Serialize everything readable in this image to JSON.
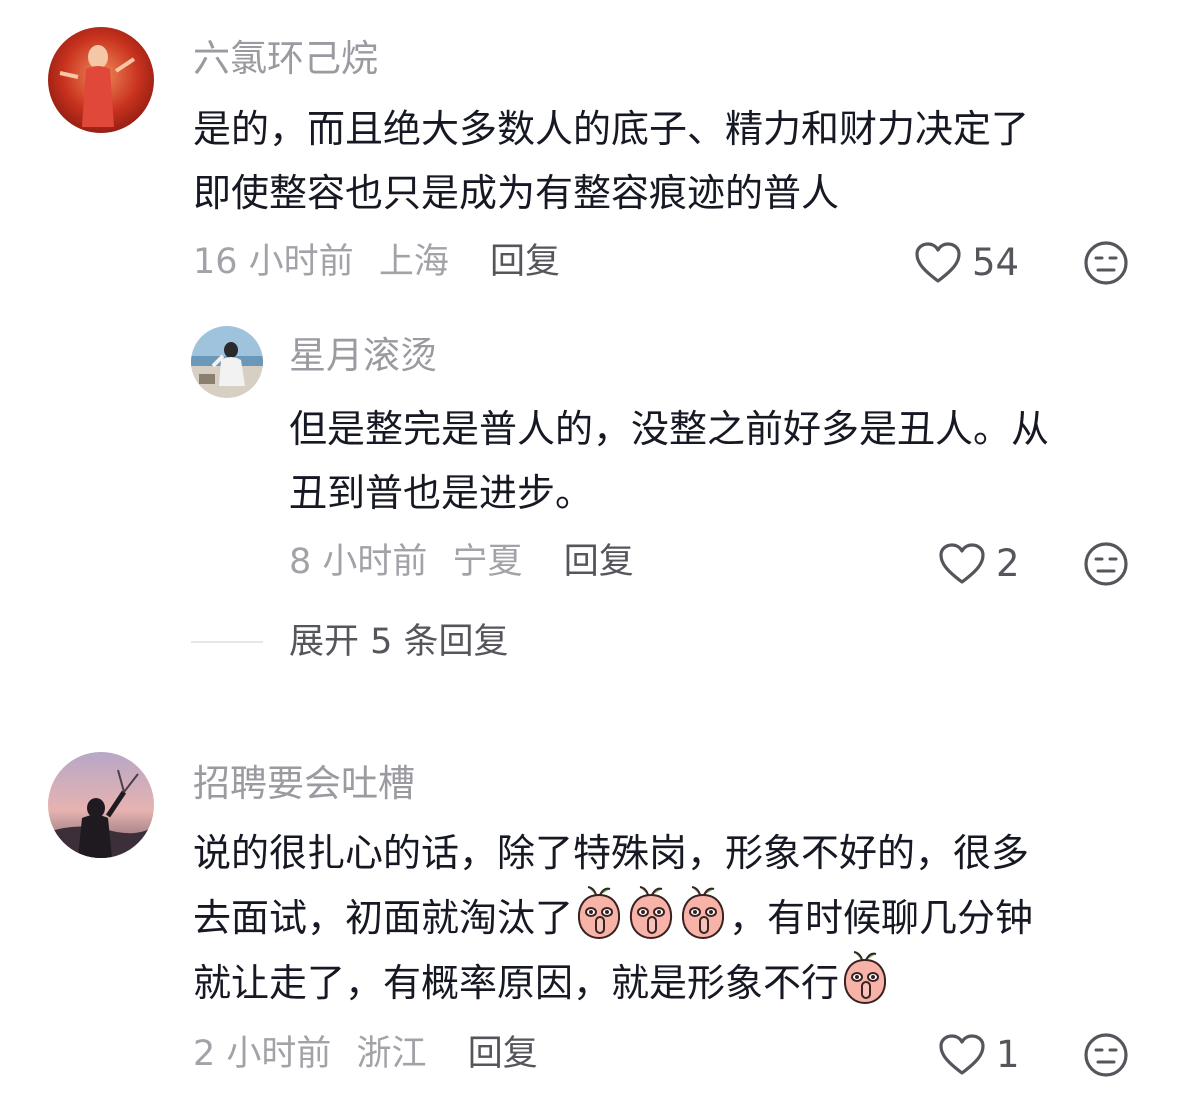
{
  "comments": [
    {
      "username": "六氯环己烷",
      "lines": [
        "是的，而且绝大多数人的底子、精力和财力决定了",
        "即使整容也只是成为有整容痕迹的普人"
      ],
      "time_location": "16 小时前 · 上海",
      "time_text": "16 小时前",
      "location": "上海",
      "reply_label": "回复",
      "likes": "54"
    },
    {
      "username": "星月滚烫",
      "lines": [
        "但是整完是普人的，没整之前好多是丑人。从",
        "丑到普也是进步。"
      ],
      "time_text": "8 小时前",
      "location": "宁夏",
      "reply_label": "回复",
      "likes": "2"
    },
    {
      "username": "招聘要会吐槽",
      "lines": [
        "说的很扎心的话，除了特殊岗，形象不好的，很多",
        "去面试，初面就淘汰了",
        "，有时候聊几分钟",
        "就让走了，有概率原因，就是形象不行"
      ],
      "time_text": "2 小时前",
      "location": "浙江",
      "reply_label": "回复",
      "likes": "1"
    }
  ],
  "expand_label": "展开 5 条回复",
  "icons": {
    "like": "heart-outline-icon",
    "dislike": "meh-face-icon",
    "emoji": "shushing-peach-emoji"
  },
  "colors": {
    "username": "#9a9aa0",
    "text": "#161823",
    "meta": "#a2a2a8",
    "action": "#55565c"
  }
}
